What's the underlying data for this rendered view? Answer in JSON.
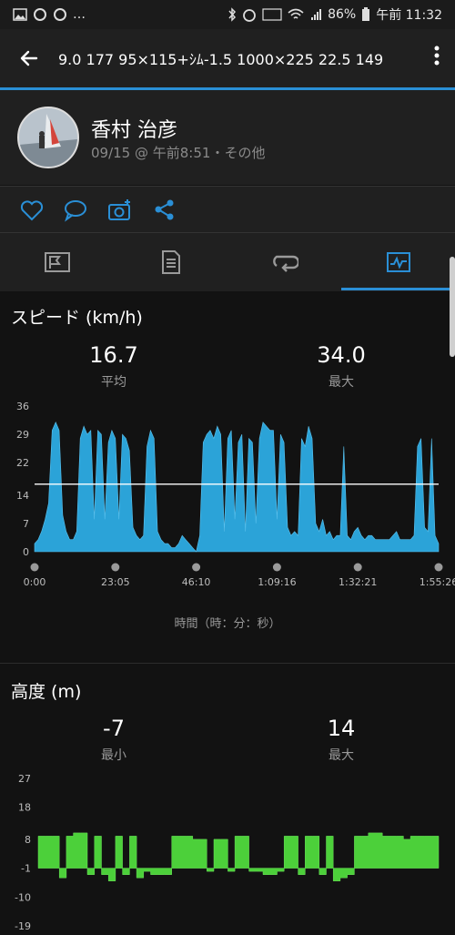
{
  "status": {
    "battery": "86%",
    "time": "午前 11:32"
  },
  "appbar": {
    "title": "9.0 177  95×115+ｼﾑ-1.5  1000×225  22.5  149"
  },
  "profile": {
    "name": "香村 治彦",
    "subtitle": "09/15 @ 午前8:51・その他"
  },
  "icons": {
    "back": "arrow-back-icon",
    "more": "more-vert-icon",
    "like": "heart-icon",
    "comment": "comment-icon",
    "photo": "camera-add-icon",
    "share": "share-icon"
  },
  "tabs": [
    {
      "name": "overview",
      "icon": "flag-chart-icon"
    },
    {
      "name": "details",
      "icon": "document-icon"
    },
    {
      "name": "laps",
      "icon": "loop-icon"
    },
    {
      "name": "charts",
      "icon": "pulse-chart-icon",
      "selected": true
    }
  ],
  "speed": {
    "title": "スピード (km/h)",
    "avg_value": "16.7",
    "avg_label": "平均",
    "max_value": "34.0",
    "max_label": "最大",
    "xlabel": "時間（時：分：秒）"
  },
  "elevation": {
    "title": "高度 (m)",
    "min_value": "-7",
    "min_label": "最小",
    "max_value": "14",
    "max_label": "最大"
  },
  "colors": {
    "accent": "#2a8fd6",
    "speed_fill": "#2ba3d8",
    "elev_fill": "#4cd03a",
    "bg": "#121212",
    "panel": "#202020"
  },
  "chart_data": [
    {
      "type": "area",
      "title": "スピード (km/h)",
      "xlabel": "時間（時：分：秒）",
      "ylabel": "",
      "yticks": [
        0,
        7,
        14,
        22,
        29,
        36
      ],
      "ylim": [
        0,
        36
      ],
      "xticks": [
        "0:00",
        "23:05",
        "46:10",
        "1:09:16",
        "1:32:21",
        "1:55:26"
      ],
      "xlim_seconds": [
        0,
        6926
      ],
      "average_line": 16.7,
      "series": [
        {
          "x_minutes": [
            0,
            1,
            2,
            3,
            4,
            5,
            6,
            7,
            8,
            9,
            10,
            11,
            12,
            13,
            14,
            15,
            16,
            17,
            18,
            19,
            20,
            21,
            22,
            23,
            24,
            25,
            26,
            27,
            28,
            29,
            30,
            31,
            32,
            33,
            34,
            35,
            36,
            37,
            38,
            39,
            40,
            41,
            42,
            43,
            44,
            45,
            46,
            47,
            48,
            49,
            50,
            51,
            52,
            53,
            54,
            55,
            56,
            57,
            58,
            59,
            60,
            61,
            62,
            63,
            64,
            65,
            66,
            67,
            68,
            69,
            70,
            71,
            72,
            73,
            74,
            75,
            76,
            77,
            78,
            79,
            80,
            81,
            82,
            83,
            84,
            85,
            86,
            87,
            88,
            89,
            90,
            91,
            92,
            93,
            94,
            95,
            96,
            97,
            98,
            99,
            100,
            101,
            102,
            103,
            104,
            105,
            106,
            107,
            108,
            109,
            110,
            111,
            112,
            113,
            114,
            115
          ],
          "values": [
            2,
            3,
            5,
            8,
            12,
            30,
            32,
            30,
            9,
            5,
            3,
            3,
            5,
            28,
            31,
            29,
            30,
            8,
            30,
            29,
            8,
            27,
            30,
            28,
            8,
            29,
            28,
            25,
            6,
            4,
            3,
            4,
            26,
            30,
            28,
            5,
            3,
            2,
            2,
            1,
            1,
            2,
            4,
            3,
            2,
            1,
            0,
            4,
            27,
            29,
            30,
            28,
            31,
            29,
            5,
            28,
            30,
            8,
            27,
            29,
            5,
            28,
            27,
            7,
            28,
            32,
            31,
            30,
            30,
            8,
            29,
            27,
            6,
            4,
            5,
            4,
            28,
            26,
            31,
            28,
            7,
            5,
            8,
            4,
            5,
            3,
            4,
            4,
            26,
            4,
            3,
            5,
            6,
            4,
            3,
            4,
            4,
            3,
            3,
            3,
            3,
            3,
            4,
            5,
            3,
            3,
            3,
            3,
            4,
            26,
            28,
            6,
            5,
            28,
            4,
            2
          ]
        }
      ]
    },
    {
      "type": "area",
      "title": "高度 (m)",
      "yticks": [
        -19,
        -10,
        -1,
        8,
        18,
        27
      ],
      "ylim": [
        -19,
        27
      ],
      "series": [
        {
          "x_minutes": [
            0,
            2,
            4,
            6,
            8,
            10,
            12,
            14,
            16,
            18,
            20,
            22,
            24,
            26,
            28,
            30,
            32,
            34,
            36,
            38,
            40,
            42,
            44,
            46,
            48,
            50,
            52,
            54,
            56,
            58,
            60,
            62,
            64,
            66,
            68,
            70,
            72,
            74,
            76,
            78,
            80,
            82,
            84,
            86,
            88,
            90,
            92,
            94,
            96,
            98,
            100,
            102,
            104,
            106,
            108,
            110,
            112,
            114
          ],
          "values": [
            9,
            9,
            9,
            -4,
            9,
            10,
            10,
            -3,
            9,
            -3,
            -5,
            9,
            -3,
            9,
            -4,
            -2,
            -3,
            -3,
            -3,
            9,
            9,
            9,
            8,
            8,
            -2,
            8,
            8,
            -2,
            9,
            9,
            -2,
            -2,
            -3,
            -3,
            -2,
            9,
            9,
            -3,
            9,
            9,
            -3,
            9,
            -5,
            -4,
            -3,
            9,
            9,
            10,
            10,
            9,
            9,
            9,
            8,
            9,
            9,
            9,
            9,
            9
          ]
        }
      ]
    }
  ]
}
